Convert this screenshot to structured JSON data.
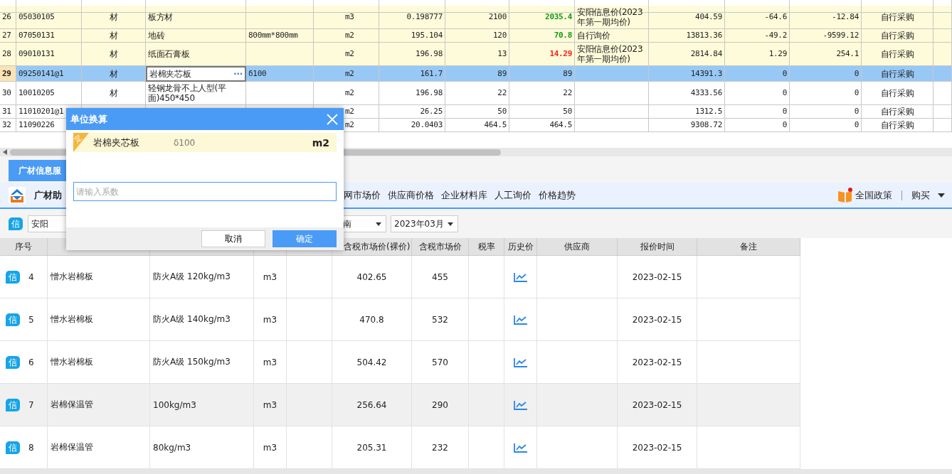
{
  "grid": {
    "rows": [
      {
        "no": "26",
        "code": "05030105",
        "type": "材",
        "name": "板方材",
        "unit": "m3",
        "qty": "0.198777",
        "price": "2100",
        "market": "2035.4",
        "color": "#139a13",
        "source": "安阳信息价(2023年第一期均价)",
        "total": "404.59",
        "diff": "-64.6",
        "diff_total": "-12.84",
        "purchase": "自行采购",
        "highlighted": true,
        "selected": false,
        "editing": false
      },
      {
        "no": "27",
        "code": "07050131",
        "type": "材",
        "name": "地砖",
        "spec": "800mm*800mm",
        "unit": "m2",
        "qty": "195.104",
        "price": "120",
        "market": "70.8",
        "color": "#139a13",
        "source": "自行询价",
        "total": "13813.36",
        "diff": "-49.2",
        "diff_total": "-9599.12",
        "purchase": "自行采购",
        "highlighted": true,
        "selected": false,
        "editing": false
      },
      {
        "no": "28",
        "code": "09010131",
        "type": "材",
        "name": "纸面石膏板",
        "unit": "m2",
        "qty": "196.98",
        "price": "13",
        "market": "14.29",
        "color": "#ff1a1a",
        "source": "安阳信息价(2023年第一期均价)",
        "total": "2814.84",
        "diff": "1.29",
        "diff_total": "254.1",
        "purchase": "自行采购",
        "highlighted": true,
        "selected": false,
        "editing": false
      },
      {
        "no": "29",
        "code": "09250141@1",
        "type": "材",
        "name": "岩棉夹芯板",
        "edit_button": "···",
        "spec": "δ100",
        "unit": "m2",
        "qty": "161.7",
        "price": "89",
        "market": "89",
        "total": "14391.3",
        "diff": "0",
        "diff_total": "0",
        "purchase": "自行采购",
        "highlighted": false,
        "selected": true,
        "editing": true
      },
      {
        "no": "30",
        "code": "10010205",
        "type": "材",
        "name": "轻钢龙骨不上人型(平面)450*450",
        "unit": "m2",
        "qty": "196.98",
        "price": "22",
        "market": "22",
        "total": "4333.56",
        "diff": "0",
        "diff_total": "0",
        "purchase": "自行采购",
        "highlighted": false,
        "selected": false,
        "editing": false
      },
      {
        "no": "31",
        "code": "11010201@1",
        "unit": "m2",
        "qty": "26.25",
        "price": "50",
        "market": "50",
        "total": "1312.5",
        "diff": "0",
        "diff_total": "0",
        "purchase": "自行采购",
        "highlighted": false,
        "selected": false,
        "editing": false
      },
      {
        "no": "32",
        "code": "11090226",
        "unit": "m2",
        "qty": "20.0403",
        "price": "464.5",
        "market": "464.5",
        "total": "9308.72",
        "diff": "0",
        "diff_total": "0",
        "purchase": "自行采购",
        "highlighted": false,
        "selected": false,
        "editing": false
      }
    ]
  },
  "tabs": [
    {
      "label": "广材信息服",
      "selected": true
    }
  ],
  "toolbar": {
    "brand": "广材助",
    "nav": [
      "网市场价",
      "供应商价格",
      "企业材料库",
      "人工询价",
      "价格趋势"
    ],
    "policy": "全国政策",
    "buy": "购买"
  },
  "filters": {
    "badge": "信",
    "region": "安阳",
    "dropdowns": [
      "南",
      "2023年03月"
    ]
  },
  "price_table": {
    "columns": [
      "序号",
      null,
      null,
      null,
      null,
      "含税市场价(裸价)",
      "含税市场价",
      "税率",
      "历史价",
      "供应商",
      "报价时间",
      "备注"
    ],
    "rows": [
      {
        "badge": "信",
        "no": "4",
        "name": "憎水岩棉板",
        "spec": "防火A级 120kg/m3",
        "unit": "m3",
        "price_bare": "402.65",
        "price": "455",
        "date": "2023-02-15",
        "selected": false
      },
      {
        "badge": "信",
        "no": "5",
        "name": "憎水岩棉板",
        "spec": "防火A级 140kg/m3",
        "unit": "m3",
        "price_bare": "470.8",
        "price": "532",
        "date": "2023-02-15",
        "selected": false
      },
      {
        "badge": "信",
        "no": "6",
        "name": "憎水岩棉板",
        "spec": "防火A级 150kg/m3",
        "unit": "m3",
        "price_bare": "504.42",
        "price": "570",
        "date": "2023-02-15",
        "selected": false
      },
      {
        "badge": "信",
        "no": "7",
        "name": "岩棉保温管",
        "spec": "100kg/m3",
        "unit": "m3",
        "price_bare": "256.64",
        "price": "290",
        "date": "2023-02-15",
        "selected": true
      },
      {
        "badge": "信",
        "no": "8",
        "name": "岩棉保温管",
        "spec": "80kg/m3",
        "unit": "m3",
        "price_bare": "205.31",
        "price": "232",
        "date": "2023-02-15",
        "selected": false
      }
    ]
  },
  "dialog": {
    "title": "单位换算",
    "tag": "定",
    "material": "岩棉夹芯板",
    "spec": "δ100",
    "unit": "m2",
    "input": {
      "placeholder": "请输入系数"
    },
    "buttons": [
      {
        "label": "取消",
        "primary": false
      },
      {
        "label": "确定",
        "primary": true
      }
    ]
  }
}
